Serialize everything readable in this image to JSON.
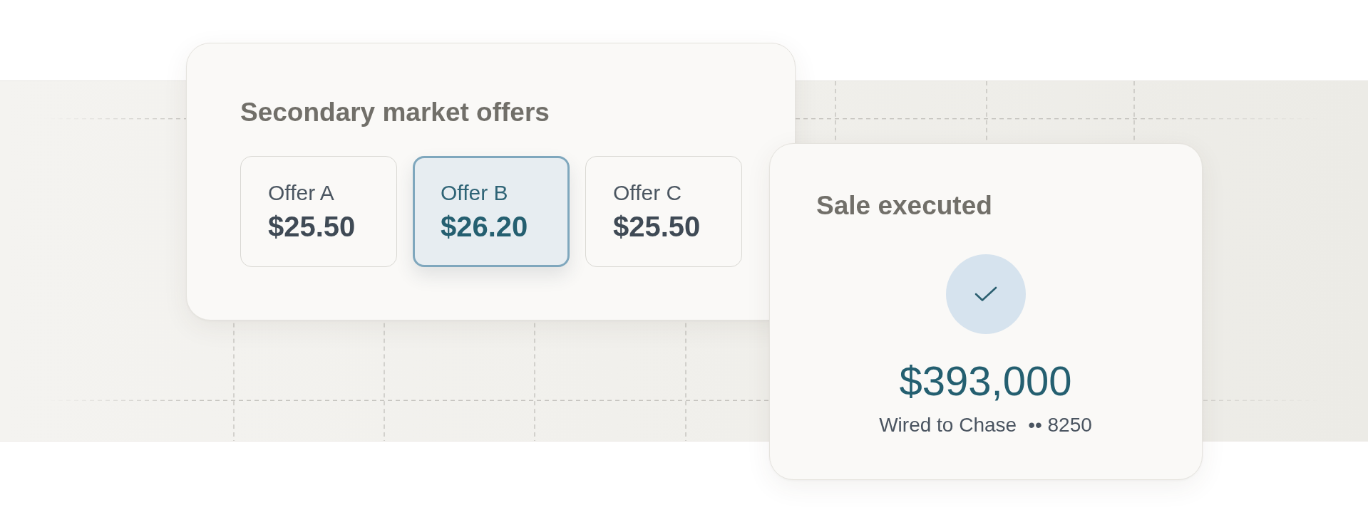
{
  "offers_card": {
    "title": "Secondary market offers",
    "offers": [
      {
        "label": "Offer A",
        "price": "$25.50",
        "selected": false
      },
      {
        "label": "Offer B",
        "price": "$26.20",
        "selected": true
      },
      {
        "label": "Offer C",
        "price": "$25.50",
        "selected": false
      }
    ]
  },
  "sale_card": {
    "title": "Sale executed",
    "amount": "$393,000",
    "destination": "Wired to Chase",
    "account": "•• 8250"
  }
}
